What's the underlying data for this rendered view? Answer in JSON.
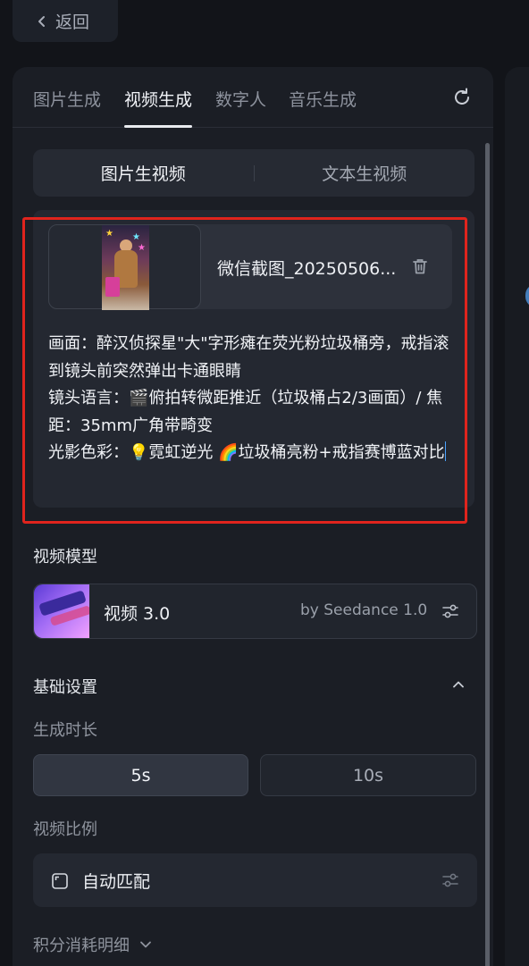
{
  "back": {
    "label": "返回"
  },
  "tabs": [
    {
      "label": "图片生成",
      "active": false
    },
    {
      "label": "视频生成",
      "active": true
    },
    {
      "label": "数字人",
      "active": false
    },
    {
      "label": "音乐生成",
      "active": false
    }
  ],
  "mode_switch": {
    "options": [
      {
        "label": "图片生视频",
        "active": true
      },
      {
        "label": "文本生视频",
        "active": false
      }
    ]
  },
  "upload": {
    "file_name": "微信截图_20250506...",
    "prompt": "画面：醉汉侦探星\"大\"字形瘫在荧光粉垃圾桶旁，戒指滚到镜头前突然弹出卡通眼睛\n镜头语言：🎬俯拍转微距推近（垃圾桶占2/3画面）/ 焦距：35mm广角带畸变\n光影色彩：💡霓虹逆光 🌈垃圾桶亮粉+戒指赛博蓝对比"
  },
  "video_model": {
    "section_title": "视频模型",
    "name": "视频 3.0",
    "by": "by Seedance 1.0"
  },
  "basic_settings": {
    "title": "基础设置",
    "duration_label": "生成时长",
    "durations": [
      {
        "label": "5s",
        "selected": true
      },
      {
        "label": "10s",
        "selected": false
      }
    ],
    "ratio_label": "视频比例",
    "ratio_value": "自动匹配"
  },
  "cost_detail": {
    "label": "积分消耗明细"
  },
  "colors": {
    "background": "#121419",
    "panel": "#1b1e25",
    "highlight_frame": "#e0241d",
    "caret": "#4aa2ff"
  }
}
